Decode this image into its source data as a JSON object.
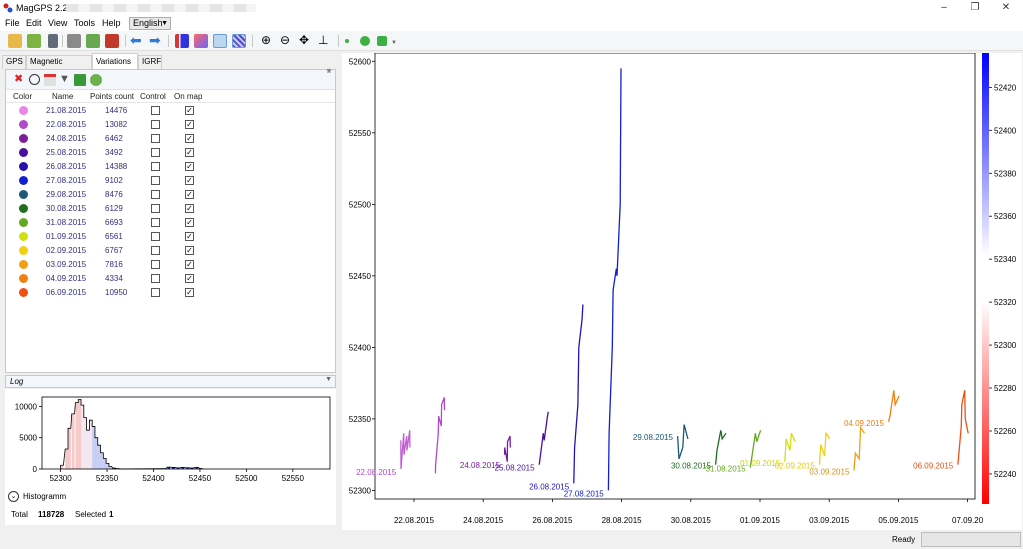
{
  "window": {
    "title": "MagGPS 2.2",
    "app_icon": "maggps-icon",
    "controls": [
      "minimize-icon",
      "maximize-icon",
      "close-icon"
    ]
  },
  "menu": {
    "items": [
      "File",
      "Edit",
      "View",
      "Tools",
      "Help"
    ],
    "language": "English"
  },
  "toolbar": {
    "icons": [
      "open-folder-icon",
      "add-file-icon",
      "save-icon",
      "print-icon",
      "export-icon",
      "import-icon",
      "back-arrow-icon",
      "forward-arrow-icon",
      "points-chart-icon",
      "gradient-map-icon",
      "selection-map-icon",
      "hatch-map-icon",
      "zoom-in-icon",
      "zoom-out-icon",
      "pan-icon",
      "axes-icon",
      "small-point-icon",
      "circle-point-icon",
      "square-point-icon"
    ]
  },
  "tabs": [
    {
      "label": "GPS",
      "active": false
    },
    {
      "label": "Magnetic survey",
      "active": false
    },
    {
      "label": "Variations",
      "active": true
    },
    {
      "label": "IGRF",
      "active": false
    }
  ],
  "variations": {
    "tool_icons": [
      "delete-icon",
      "clock-icon",
      "calendar-icon",
      "filter-icon",
      "folder-icon",
      "globe-icon"
    ],
    "columns": [
      "Color",
      "Name",
      "Points count",
      "Control",
      "On map"
    ],
    "rows": [
      {
        "color": "#ee82ee",
        "name": "21.08.2015",
        "points": "14476",
        "control": false,
        "on_map": true
      },
      {
        "color": "#b04ac8",
        "name": "22.08.2015",
        "points": "13082",
        "control": false,
        "on_map": true
      },
      {
        "color": "#7a1e9a",
        "name": "24.08.2015",
        "points": "6462",
        "control": false,
        "on_map": true
      },
      {
        "color": "#4b0f9e",
        "name": "25.08.2015",
        "points": "3492",
        "control": false,
        "on_map": true
      },
      {
        "color": "#2a10b0",
        "name": "26.08.2015",
        "points": "14388",
        "control": false,
        "on_map": true
      },
      {
        "color": "#1020d0",
        "name": "27.08.2015",
        "points": "9102",
        "control": false,
        "on_map": true
      },
      {
        "color": "#1a5a78",
        "name": "29.08.2015",
        "points": "8476",
        "control": false,
        "on_map": true
      },
      {
        "color": "#1e6e1e",
        "name": "30.08.2015",
        "points": "6129",
        "control": false,
        "on_map": true
      },
      {
        "color": "#66a820",
        "name": "31.08.2015",
        "points": "6693",
        "control": false,
        "on_map": true
      },
      {
        "color": "#d0e010",
        "name": "01.09.2015",
        "points": "6561",
        "control": false,
        "on_map": true
      },
      {
        "color": "#f0d010",
        "name": "02.09.2015",
        "points": "6767",
        "control": false,
        "on_map": true
      },
      {
        "color": "#f0a010",
        "name": "03.09.2015",
        "points": "7816",
        "control": false,
        "on_map": true
      },
      {
        "color": "#f08010",
        "name": "04.09.2015",
        "points": "4334",
        "control": false,
        "on_map": true
      },
      {
        "color": "#f05010",
        "name": "06.09.2015",
        "points": "10950",
        "control": false,
        "on_map": true
      }
    ]
  },
  "log": {
    "label": "Log"
  },
  "histogram": {
    "label": "Histogramm",
    "y_ticks": [
      "10000",
      "5000",
      "0"
    ],
    "x_ticks": [
      "52300",
      "52350",
      "52400",
      "52450",
      "52500",
      "52550"
    ],
    "xlim": [
      52280,
      52590
    ],
    "ylim": [
      0,
      11500
    ],
    "bins": [
      [
        52300,
        600
      ],
      [
        52305,
        3200
      ],
      [
        52308,
        6500
      ],
      [
        52312,
        8800
      ],
      [
        52316,
        10600
      ],
      [
        52319,
        11100
      ],
      [
        52322,
        10200
      ],
      [
        52325,
        8200
      ],
      [
        52328,
        6200
      ],
      [
        52331,
        7800
      ],
      [
        52334,
        6800
      ],
      [
        52337,
        5000
      ],
      [
        52340,
        3800
      ],
      [
        52343,
        2600
      ],
      [
        52346,
        1700
      ],
      [
        52349,
        900
      ],
      [
        52352,
        400
      ],
      [
        52356,
        150
      ],
      [
        52360,
        60
      ],
      [
        52365,
        20
      ],
      [
        52410,
        50
      ],
      [
        52415,
        300
      ],
      [
        52420,
        250
      ],
      [
        52425,
        180
      ],
      [
        52430,
        260
      ],
      [
        52435,
        200
      ],
      [
        52440,
        150
      ],
      [
        52445,
        260
      ],
      [
        52450,
        80
      ]
    ],
    "total_label": "Total",
    "total_value": "118728",
    "selected_label": "Selected",
    "selected_value": "1"
  },
  "chart_data": {
    "type": "line",
    "x_ticks": [
      "22.08.2015",
      "24.08.2015",
      "26.08.2015",
      "28.08.2015",
      "30.08.2015",
      "01.09.2015",
      "03.09.2015",
      "05.09.2015",
      "07.09.20"
    ],
    "y_ticks": [
      "52300",
      "52350",
      "52400",
      "52450",
      "52500",
      "52550",
      "52600"
    ],
    "ylim": [
      52294,
      52603
    ],
    "colorbar": {
      "ticks": [
        "52420",
        "52400",
        "52380",
        "52360",
        "52340",
        "52320",
        "52300",
        "52280",
        "52260",
        "52240"
      ],
      "range": [
        52226,
        52436
      ]
    },
    "series": [
      {
        "label": "22.08.2015",
        "color": "#c060d0",
        "label_color": "#b04ac8",
        "x0": 21.6,
        "width": 0.3,
        "points": [
          52335,
          52315,
          52340,
          52325,
          52338,
          52328,
          52342,
          52330
        ]
      },
      {
        "label": "",
        "color": "#b04ac8",
        "x0": 22.6,
        "width": 0.3,
        "points": [
          52312,
          52318,
          52340,
          52352,
          52345,
          52360,
          52365,
          52356
        ]
      },
      {
        "label": "24.08.2015",
        "color": "#7a1e9a",
        "label_color": "#7a1e9a",
        "x0": 24.6,
        "width": 0.2,
        "points": [
          52325,
          52330,
          52320,
          52334,
          52338,
          52330
        ]
      },
      {
        "label": "25.08.2015",
        "color": "#4b0f9e",
        "label_color": "#4b0f9e",
        "x0": 25.6,
        "width": 0.3,
        "points": [
          52318,
          52322,
          52340,
          52335,
          52352,
          52355
        ]
      },
      {
        "label": "26.08.2015",
        "color": "#2a10b0",
        "label_color": "#2a10b0",
        "x0": 26.6,
        "width": 0.3,
        "points": [
          52305,
          52330,
          52360,
          52400,
          52420,
          52430
        ]
      },
      {
        "label": "27.08.2015",
        "color": "#1020d0",
        "label_color": "#1020d0",
        "x0": 27.6,
        "width": 0.4,
        "points": [
          52300,
          52340,
          52400,
          52440,
          52455,
          52450,
          52500,
          52595
        ]
      },
      {
        "label": "29.08.2015",
        "color": "#1a5a78",
        "label_color": "#1a5a78",
        "x0": 29.6,
        "width": 0.3,
        "points": [
          52338,
          52322,
          52330,
          52346,
          52336
        ]
      },
      {
        "label": "30.08.2015",
        "color": "#1e6e1e",
        "label_color": "#1e6e1e",
        "x0": 30.7,
        "width": 0.3,
        "points": [
          52318,
          52328,
          52342,
          52336,
          52340
        ]
      },
      {
        "label": "31.08.2015",
        "color": "#66a820",
        "label_color": "#66a820",
        "x0": 31.7,
        "width": 0.3,
        "points": [
          52316,
          52322,
          52340,
          52334,
          52342
        ]
      },
      {
        "label": "01.09.2015",
        "color": "#d0e010",
        "label_color": "#c8d810",
        "x0": 32.7,
        "width": 0.3,
        "points": [
          52320,
          52336,
          52328,
          52340,
          52334
        ]
      },
      {
        "label": "02.09.2015",
        "color": "#f0d010",
        "label_color": "#e8c810",
        "x0": 33.7,
        "width": 0.3,
        "points": [
          52318,
          52332,
          52324,
          52340,
          52336
        ]
      },
      {
        "label": "03.09.2015",
        "color": "#f0a010",
        "label_color": "#e09010",
        "x0": 34.7,
        "width": 0.3,
        "points": [
          52314,
          52326,
          52322,
          52344,
          52340
        ]
      },
      {
        "label": "04.09.2015",
        "color": "#f08010",
        "label_color": "#f08010",
        "x0": 35.7,
        "width": 0.3,
        "points": [
          52348,
          52352,
          52370,
          52360,
          52366
        ]
      },
      {
        "label": "06.09.2015",
        "color": "#f05010",
        "label_color": "#f05010",
        "x0": 37.7,
        "width": 0.3,
        "points": [
          52318,
          52322,
          52345,
          52360,
          52370,
          52350,
          52340
        ]
      }
    ]
  },
  "status": {
    "text": "Ready",
    "progress": 0
  }
}
